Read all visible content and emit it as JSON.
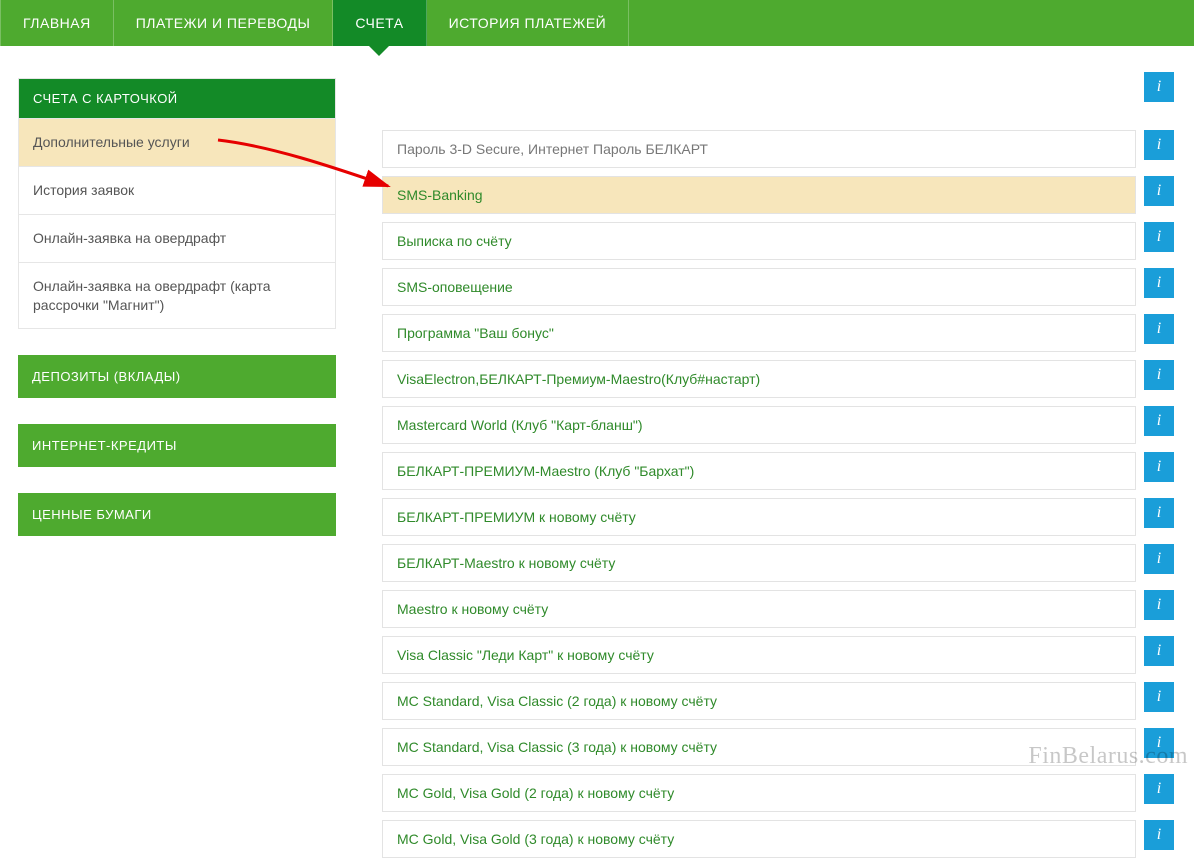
{
  "topnav": {
    "tabs": [
      {
        "label": "ГЛАВНАЯ",
        "active": false
      },
      {
        "label": "ПЛАТЕЖИ И ПЕРЕВОДЫ",
        "active": false
      },
      {
        "label": "СЧЕТА",
        "active": true
      },
      {
        "label": "ИСТОРИЯ ПЛАТЕЖЕЙ",
        "active": false
      }
    ]
  },
  "sidebar": {
    "cards_header": "СЧЕТА С КАРТОЧКОЙ",
    "cards_items": [
      {
        "label": "Дополнительные услуги",
        "active": true
      },
      {
        "label": "История заявок",
        "active": false
      },
      {
        "label": "Онлайн-заявка на овердрафт",
        "active": false
      },
      {
        "label": "Онлайн-заявка на овердрафт (карта рассрочки \"Магнит\")",
        "active": false
      }
    ],
    "sections": [
      "ДЕПОЗИТЫ (ВКЛАДЫ)",
      "ИНТЕРНЕТ-КРЕДИТЫ",
      "ЦЕННЫЕ БУМАГИ"
    ]
  },
  "main": {
    "items": [
      {
        "label": "Пароль 3-D Secure, Интернет Пароль БЕЛКАРТ",
        "highlight": false,
        "muted": true
      },
      {
        "label": "SMS-Banking",
        "highlight": true,
        "muted": false
      },
      {
        "label": "Выписка по счёту",
        "highlight": false,
        "muted": false
      },
      {
        "label": "SMS-оповещение",
        "highlight": false,
        "muted": false
      },
      {
        "label": "Программа \"Ваш бонус\"",
        "highlight": false,
        "muted": false
      },
      {
        "label": "VisaElectron,БЕЛКАРТ-Премиум-Maestro(Клуб#настарт)",
        "highlight": false,
        "muted": false
      },
      {
        "label": "Mastercard World (Клуб \"Карт-бланш\")",
        "highlight": false,
        "muted": false
      },
      {
        "label": "БЕЛКАРТ-ПРЕМИУМ-Maestro (Клуб \"Бархат\")",
        "highlight": false,
        "muted": false
      },
      {
        "label": "БЕЛКАРТ-ПРЕМИУМ к новому счёту",
        "highlight": false,
        "muted": false
      },
      {
        "label": "БЕЛКАРТ-Maestro к новому счёту",
        "highlight": false,
        "muted": false
      },
      {
        "label": "Maestro к новому счёту",
        "highlight": false,
        "muted": false
      },
      {
        "label": "Visa Classic \"Леди Карт\" к новому счёту",
        "highlight": false,
        "muted": false
      },
      {
        "label": "MC Standard, Visa Classic (2 года) к новому счёту",
        "highlight": false,
        "muted": false
      },
      {
        "label": "MC Standard, Visa Classic (3 года) к новому счёту",
        "highlight": false,
        "muted": false
      },
      {
        "label": "MC Gold, Visa Gold (2 года) к новому счёту",
        "highlight": false,
        "muted": false
      },
      {
        "label": "MC Gold, Visa Gold (3 года) к новому счёту",
        "highlight": false,
        "muted": false
      }
    ]
  },
  "info_glyph": "i",
  "watermark": "FinBelarus.com"
}
